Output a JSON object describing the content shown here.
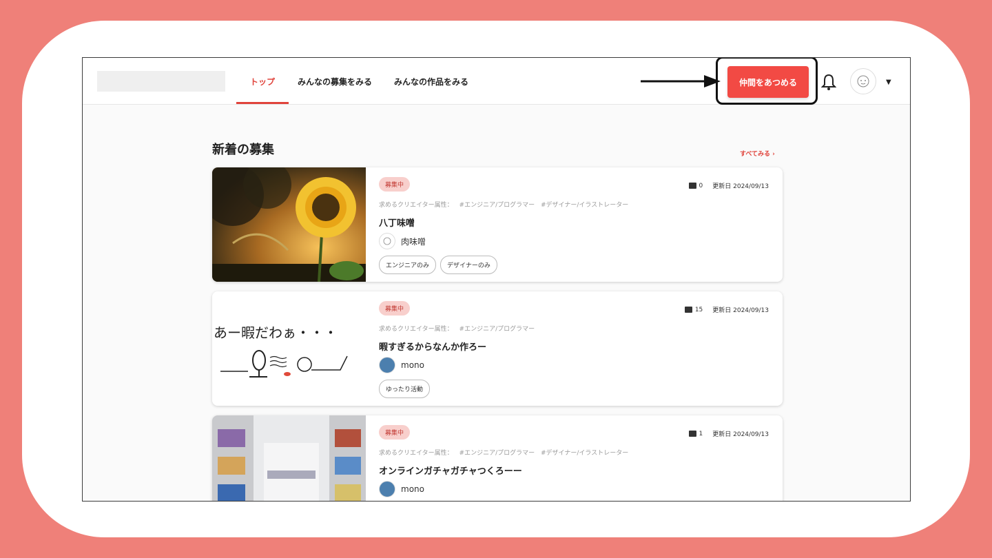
{
  "nav": {
    "items": [
      {
        "label": "トップ",
        "active": true
      },
      {
        "label": "みんなの募集をみる",
        "active": false
      },
      {
        "label": "みんなの作品をみる",
        "active": false
      }
    ],
    "cta_label": "仲間をあつめる"
  },
  "section": {
    "title": "新着の募集",
    "see_all": "すべてみる ›"
  },
  "attr_prefix": "求めるクリエイター属性：",
  "cards": [
    {
      "status": "募集中",
      "comments": "0",
      "updated": "更新日 2024/09/13",
      "attrs": [
        "#エンジニア/プログラマー",
        "#デザイナー/イラストレーター"
      ],
      "title": "八丁味噌",
      "author": "肉味噌",
      "tags": [
        "エンジニアのみ",
        "デザイナーのみ"
      ]
    },
    {
      "status": "募集中",
      "comments": "15",
      "updated": "更新日 2024/09/13",
      "attrs": [
        "#エンジニア/プログラマー"
      ],
      "title": "暇すぎるからなんか作ろー",
      "author": "mono",
      "tags": [
        "ゆったり活動"
      ],
      "thumb_text": "あー暇だわぁ・・・"
    },
    {
      "status": "募集中",
      "comments": "1",
      "updated": "更新日 2024/09/13",
      "attrs": [
        "#エンジニア/プログラマー",
        "#デザイナー/イラストレーター"
      ],
      "title": "オンラインガチャガチャつくろーー",
      "author": "mono",
      "tags": []
    }
  ],
  "colors": {
    "accent": "#e0433b",
    "cta": "#f24a44",
    "badge_bg": "#f8cfcc",
    "outer_bg": "#ef8079"
  }
}
